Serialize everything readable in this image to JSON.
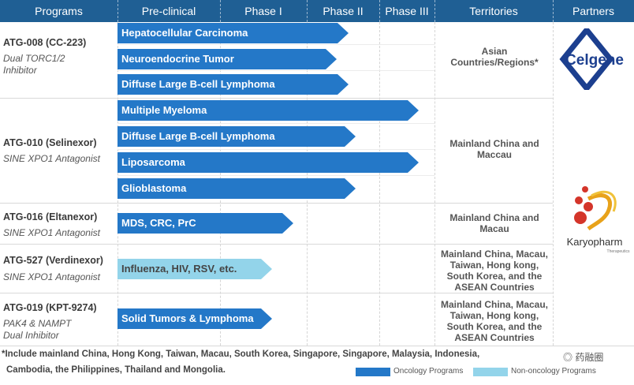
{
  "header": [
    "Programs",
    "Pre-clinical",
    "Phase I",
    "Phase II",
    "Phase III",
    "Territories",
    "Partners"
  ],
  "programs": [
    {
      "name": "ATG-008 (CC-223)",
      "desc": "Dual TORC1/2\nInhibitor"
    },
    {
      "name": "ATG-010 (Selinexor)",
      "desc": "SINE XPO1 Antagonist"
    },
    {
      "name": "ATG-016 (Eltanexor)",
      "desc": "SINE XPO1 Antagonist"
    },
    {
      "name": "ATG-527 (Verdinexor)",
      "desc": "SINE XPO1 Antagonist"
    },
    {
      "name": "ATG-019 (KPT-9274)",
      "desc": "PAK4 & NAMPT\nDual Inhibitor"
    }
  ],
  "indications": [
    {
      "label": "Hepatocellular Carcinoma",
      "type": "oncology",
      "progress_phase": "Phase I"
    },
    {
      "label": "Neuroendocrine Tumor",
      "type": "oncology",
      "progress_phase": "Phase I"
    },
    {
      "label": "Diffuse Large B-cell Lymphoma",
      "type": "oncology",
      "progress_phase": "Phase I"
    },
    {
      "label": "Multiple Myeloma",
      "type": "oncology",
      "progress_phase": "Phase III"
    },
    {
      "label": "Diffuse Large B-cell Lymphoma",
      "type": "oncology",
      "progress_phase": "Phase II"
    },
    {
      "label": "Liposarcoma",
      "type": "oncology",
      "progress_phase": "Phase III"
    },
    {
      "label": "Glioblastoma",
      "type": "oncology",
      "progress_phase": "Phase II"
    },
    {
      "label": "MDS, CRC, PrC",
      "type": "oncology",
      "progress_phase": "Phase I"
    },
    {
      "label": "Influenza, HIV, RSV, etc.",
      "type": "non-oncology",
      "progress_phase": "Pre-clinical"
    },
    {
      "label": "Solid Tumors & Lymphoma",
      "type": "oncology",
      "progress_phase": "Pre-clinical"
    }
  ],
  "territories": [
    "Asian\nCountries/Regions*",
    "Mainland China and\nMaccau",
    "Mainland China and\nMacau",
    "Mainland China, Macau,\nTaiwan, Hong kong,\nSouth Korea, and the\nASEAN Countries",
    "Mainland China, Macau,\nTaiwan, Hong kong,\nSouth Korea, and the\nASEAN Countries"
  ],
  "partners": {
    "celgene": "Celgene",
    "karyopharm": "Karyopharm",
    "karyopharm_sub": "Therapeutics"
  },
  "footnote": {
    "line1": "*Include mainland China, Hong Kong, Taiwan, Macau, South Korea, Singapore, Singapore, Malaysia, Indonesia,",
    "line2": "Cambodia, the Philippines, Thailand and Mongolia."
  },
  "legend": {
    "oncology": "Oncology Programs",
    "non_oncology": "Non-oncology Programs"
  },
  "watermark": "药融圈",
  "colors": {
    "header": "#1f5f94",
    "oncology": "#2478c8",
    "non_oncology": "#93d4ea",
    "celgene": "#1c3f8f",
    "karyopharm_red": "#d4352a",
    "karyopharm_yellow": "#e8a21a"
  }
}
